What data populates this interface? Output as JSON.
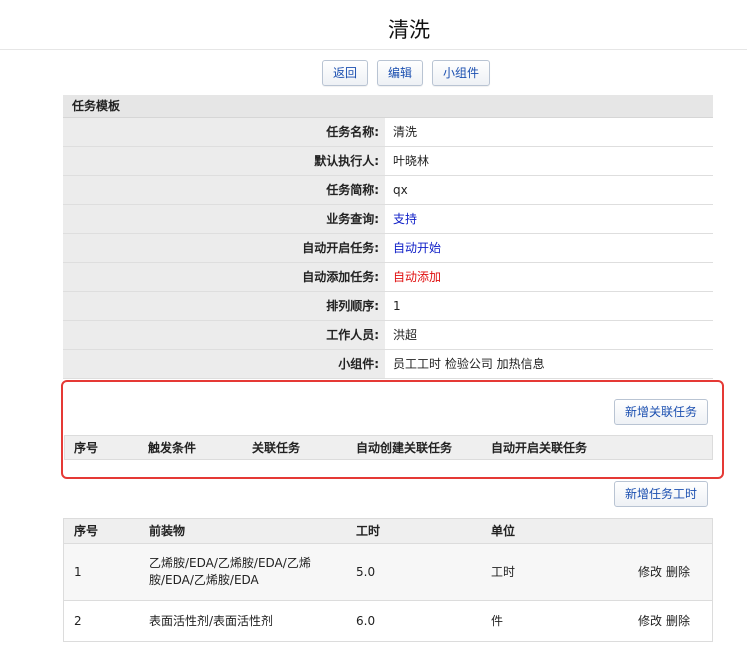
{
  "page": {
    "title": "清洗"
  },
  "toolbar": {
    "back_label": "返回",
    "edit_label": "编辑",
    "widget_label": "小组件"
  },
  "template": {
    "header": "任务模板",
    "rows": [
      {
        "label": "任务名称:",
        "value": "清洗"
      },
      {
        "label": "默认执行人:",
        "value": "叶晓林"
      },
      {
        "label": "任务简称:",
        "value": "qx"
      },
      {
        "label": "业务查询:",
        "value": "支持"
      },
      {
        "label": "自动开启任务:",
        "value": "自动开始"
      },
      {
        "label": "自动添加任务:",
        "value": "自动添加"
      },
      {
        "label": "排列顺序:",
        "value": "1"
      },
      {
        "label": "工作人员:",
        "value": "洪超"
      },
      {
        "label": "小组件:",
        "value": "员工工时 检验公司 加热信息"
      }
    ]
  },
  "related_tasks": {
    "add_button": "新增关联任务",
    "columns": [
      "序号",
      "触发条件",
      "关联任务",
      "自动创建关联任务",
      "自动开启关联任务"
    ],
    "rows": []
  },
  "task_hours": {
    "add_button": "新增任务工时",
    "columns": [
      "序号",
      "前装物",
      "工时",
      "单位"
    ],
    "rows": [
      {
        "index": "1",
        "material": "乙烯胺/EDA/乙烯胺/EDA/乙烯胺/EDA/乙烯胺/EDA",
        "hours": "5.0",
        "unit": "工时",
        "edit": "修改",
        "delete": "删除"
      },
      {
        "index": "2",
        "material": "表面活性剂/表面活性剂",
        "hours": "6.0",
        "unit": "件",
        "edit": "修改",
        "delete": "删除"
      }
    ]
  },
  "colors": {
    "link_blue": "#1020c8",
    "alert_red": "#e01010",
    "highlight_border": "#e53935",
    "button_text": "#1b4fb0"
  }
}
